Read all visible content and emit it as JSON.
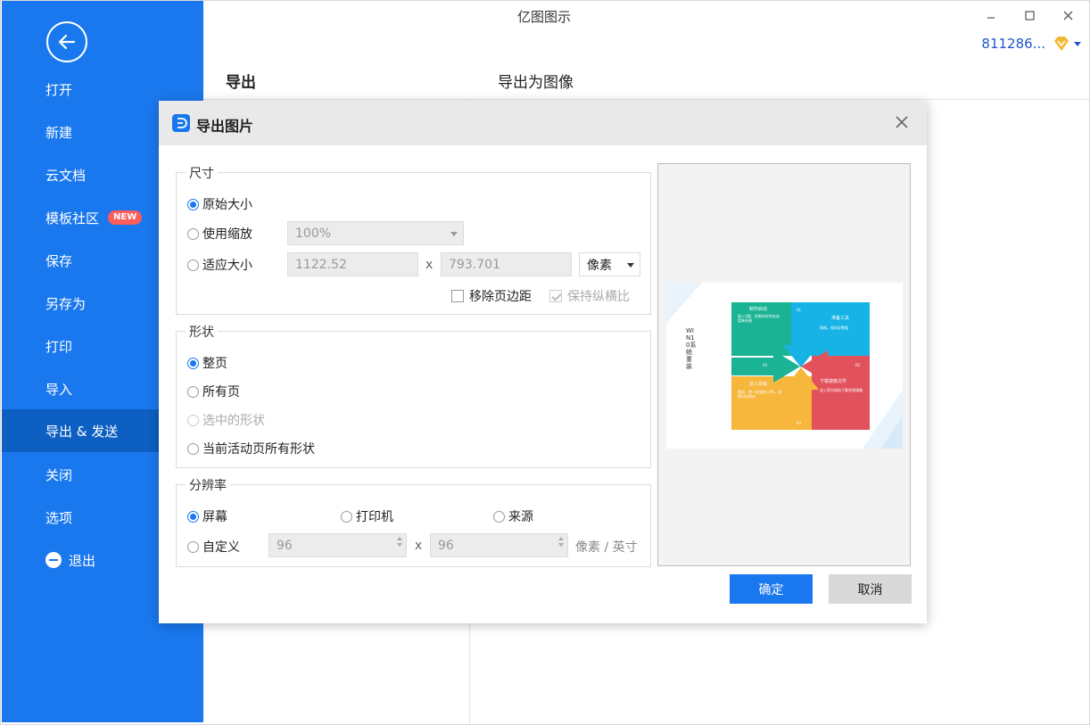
{
  "app": {
    "title": "亿图图示",
    "user": "811286..."
  },
  "sidebar": {
    "items": [
      {
        "label": "打开"
      },
      {
        "label": "新建"
      },
      {
        "label": "云文档"
      },
      {
        "label": "模板社区",
        "badge": "NEW"
      },
      {
        "label": "保存"
      },
      {
        "label": "另存为"
      },
      {
        "label": "打印"
      },
      {
        "label": "导入"
      },
      {
        "label": "导出 & 发送",
        "active": true
      },
      {
        "label": "关闭"
      },
      {
        "label": "选项"
      },
      {
        "label": "退出"
      }
    ]
  },
  "page": {
    "left_title": "导出",
    "right_title": "导出为图像"
  },
  "dialog": {
    "title": "导出图片",
    "size": {
      "label": "尺寸",
      "original": "原始大小",
      "use_scale": "使用缩放",
      "scale_value": "100%",
      "fit_size": "适应大小",
      "width": "1122.52",
      "height": "793.701",
      "x": "x",
      "unit": "像素",
      "remove_margin": "移除页边距",
      "keep_ratio": "保持纵横比"
    },
    "shape": {
      "label": "形状",
      "whole_page": "整页",
      "all_pages": "所有页",
      "selected": "选中的形状",
      "active_page_all": "当前活动页所有形状"
    },
    "resolution": {
      "label": "分辨率",
      "screen": "屏幕",
      "printer": "打印机",
      "source": "来源",
      "custom": "自定义",
      "dpi_x": "96",
      "dpi_y": "96",
      "x": "x",
      "unit": "像素 / 英寸"
    },
    "preview": {
      "vertical_title": "WIN10系统重装",
      "cells": [
        {
          "title": "制作启动",
          "text": "插入U盘，用制作好的启动盘装系统"
        },
        {
          "title": "准备工具",
          "text": "网络，保存好数据"
        },
        {
          "title": "进入安装",
          "text": "重启，按一定键进入PE，选择对应版本"
        },
        {
          "title": "下载镜像文件",
          "text": "进入官方网站下载系统镜像"
        }
      ],
      "numbers": [
        "01",
        "02",
        "03",
        "04"
      ]
    },
    "ok": "确定",
    "cancel": "取消"
  },
  "colors": {
    "accent": "#1a78ee",
    "teal": "#1ab394",
    "sky": "#17b3e6",
    "red": "#e2525c",
    "yellow": "#f6b73c"
  }
}
